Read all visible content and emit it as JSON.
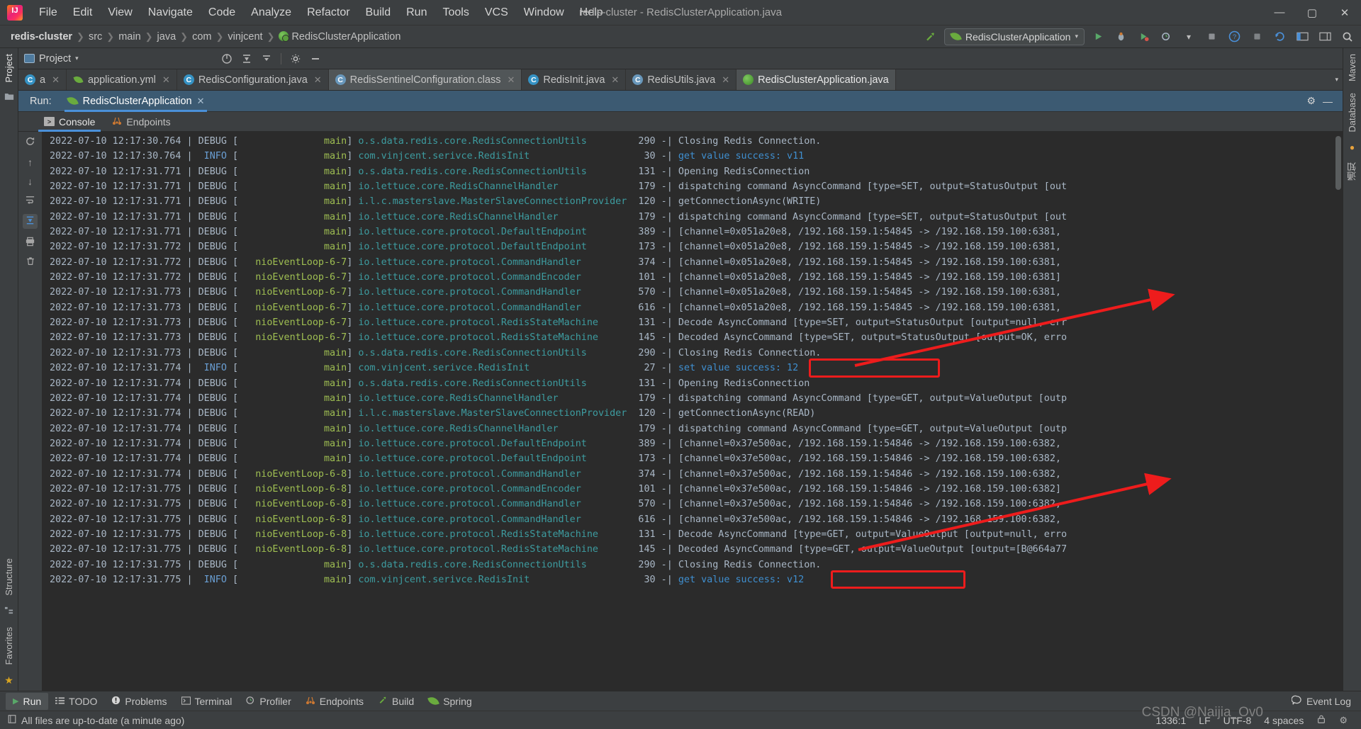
{
  "window": {
    "title": "redis-cluster - RedisClusterApplication.java",
    "minimize": "—",
    "maximize": "▢",
    "close": "✕"
  },
  "menu": {
    "items": [
      "File",
      "Edit",
      "View",
      "Navigate",
      "Code",
      "Analyze",
      "Refactor",
      "Build",
      "Run",
      "Tools",
      "VCS",
      "Window",
      "Help"
    ]
  },
  "breadcrumb": {
    "separator": "❯",
    "items": [
      "redis-cluster",
      "src",
      "main",
      "java",
      "com",
      "vinjcent",
      "RedisClusterApplication"
    ]
  },
  "toolbar": {
    "run_config": "RedisClusterApplication",
    "run_config_caret": "▾",
    "icons": {
      "build_hammer": "build-hammer-icon",
      "run": "▶",
      "debug": "debug-icon",
      "run_with_coverage": "coverage-icon",
      "profiler": "profiler-icon",
      "profiler_caret": "▾",
      "stop": "■",
      "help": "?",
      "update": "update-icon",
      "search": "🔍",
      "layout": "layout-icon",
      "settings_blue": "settings-icon"
    }
  },
  "project_panel": {
    "label": "Project",
    "caret": "▾",
    "tools": [
      "locate-icon",
      "expand-all-icon",
      "collapse-all-icon",
      "settings-gear-icon",
      "hide-icon"
    ]
  },
  "editor_tabs": [
    {
      "label": "a",
      "type": "java",
      "close": "✕",
      "selected": false
    },
    {
      "label": "application.yml",
      "type": "yml",
      "close": "✕",
      "selected": false
    },
    {
      "label": "RedisConfiguration.java",
      "type": "java",
      "close": "✕",
      "selected": false
    },
    {
      "label": "RedisSentinelConfiguration.class",
      "type": "javac",
      "close": "✕",
      "selected": false,
      "active_file": true
    },
    {
      "label": "RedisInit.java",
      "type": "java",
      "close": "✕",
      "selected": false
    },
    {
      "label": "RedisUtils.java",
      "type": "javac",
      "close": "✕",
      "selected": false
    },
    {
      "label": "RedisClusterApplication.java",
      "type": "spring-app",
      "close": "✕",
      "selected": true
    }
  ],
  "editor_tabs_overflow": "▾",
  "run_window": {
    "label": "Run:",
    "tab_title": "RedisClusterApplication",
    "tab_close": "✕",
    "settings_icon": "⚙",
    "minimize_icon": "—",
    "console_tabs": [
      {
        "label": "Console",
        "icon": "console-icon",
        "selected": true
      },
      {
        "label": "Endpoints",
        "icon": "endpoints-icon",
        "selected": false
      }
    ],
    "gutter_icons": [
      "rerun-icon",
      "scroll-up-icon",
      "scroll-down-icon",
      "soft-wrap-icon",
      "scroll-to-end-icon",
      "print-icon",
      "clear-all-icon"
    ]
  },
  "console_log": {
    "lines": [
      {
        "ts": "2022-07-10 12:17:30.764",
        "level": "DEBUG",
        "thread": "main",
        "logger": "o.s.data.redis.core.RedisConnectionUtils",
        "ln": "290",
        "msg": "Closing Redis Connection.",
        "msg_blue": false
      },
      {
        "ts": "2022-07-10 12:17:30.764",
        "level": "INFO",
        "thread": "main",
        "logger": "com.vinjcent.serivce.RedisInit",
        "ln": "30",
        "msg": "get value success: v11",
        "msg_blue": true
      },
      {
        "ts": "2022-07-10 12:17:31.771",
        "level": "DEBUG",
        "thread": "main",
        "logger": "o.s.data.redis.core.RedisConnectionUtils",
        "ln": "131",
        "msg": "Opening RedisConnection",
        "msg_blue": false
      },
      {
        "ts": "2022-07-10 12:17:31.771",
        "level": "DEBUG",
        "thread": "main",
        "logger": "io.lettuce.core.RedisChannelHandler",
        "ln": "179",
        "msg": "dispatching command AsyncCommand [type=SET, output=StatusOutput [out",
        "msg_blue": false
      },
      {
        "ts": "2022-07-10 12:17:31.771",
        "level": "DEBUG",
        "thread": "main",
        "logger": "i.l.c.masterslave.MasterSlaveConnectionProvider",
        "ln": "120",
        "msg": "getConnectionAsync(WRITE)",
        "msg_blue": false
      },
      {
        "ts": "2022-07-10 12:17:31.771",
        "level": "DEBUG",
        "thread": "main",
        "logger": "io.lettuce.core.RedisChannelHandler",
        "ln": "179",
        "msg": "dispatching command AsyncCommand [type=SET, output=StatusOutput [out",
        "msg_blue": false
      },
      {
        "ts": "2022-07-10 12:17:31.771",
        "level": "DEBUG",
        "thread": "main",
        "logger": "io.lettuce.core.protocol.DefaultEndpoint",
        "ln": "389",
        "msg": "[channel=0x051a20e8, /192.168.159.1:54845 -> /192.168.159.100:6381,",
        "msg_blue": false
      },
      {
        "ts": "2022-07-10 12:17:31.772",
        "level": "DEBUG",
        "thread": "main",
        "logger": "io.lettuce.core.protocol.DefaultEndpoint",
        "ln": "173",
        "msg": "[channel=0x051a20e8, /192.168.159.1:54845 -> /192.168.159.100:6381,",
        "msg_blue": false
      },
      {
        "ts": "2022-07-10 12:17:31.772",
        "level": "DEBUG",
        "thread": "nioEventLoop-6-7",
        "logger": "io.lettuce.core.protocol.CommandHandler",
        "ln": "374",
        "msg": "[channel=0x051a20e8, /192.168.159.1:54845 -> /192.168.159.100:6381,",
        "msg_blue": false
      },
      {
        "ts": "2022-07-10 12:17:31.772",
        "level": "DEBUG",
        "thread": "nioEventLoop-6-7",
        "logger": "io.lettuce.core.protocol.CommandEncoder",
        "ln": "101",
        "msg": "[channel=0x051a20e8, /192.168.159.1:54845 -> /192.168.159.100:6381]",
        "msg_blue": false
      },
      {
        "ts": "2022-07-10 12:17:31.773",
        "level": "DEBUG",
        "thread": "nioEventLoop-6-7",
        "logger": "io.lettuce.core.protocol.CommandHandler",
        "ln": "570",
        "msg": "[channel=0x051a20e8, /192.168.159.1:54845 -> /192.168.159.100:6381,",
        "msg_blue": false
      },
      {
        "ts": "2022-07-10 12:17:31.773",
        "level": "DEBUG",
        "thread": "nioEventLoop-6-7",
        "logger": "io.lettuce.core.protocol.CommandHandler",
        "ln": "616",
        "msg": "[channel=0x051a20e8, /192.168.159.1:54845 -> /192.168.159.100:6381,",
        "msg_blue": false
      },
      {
        "ts": "2022-07-10 12:17:31.773",
        "level": "DEBUG",
        "thread": "nioEventLoop-6-7",
        "logger": "io.lettuce.core.protocol.RedisStateMachine",
        "ln": "131",
        "msg": "Decode AsyncCommand [type=SET, output=StatusOutput [output=null, err",
        "msg_blue": false
      },
      {
        "ts": "2022-07-10 12:17:31.773",
        "level": "DEBUG",
        "thread": "nioEventLoop-6-7",
        "logger": "io.lettuce.core.protocol.RedisStateMachine",
        "ln": "145",
        "msg": "Decoded AsyncCommand [type=SET, output=StatusOutput [output=OK, erro",
        "msg_blue": false
      },
      {
        "ts": "2022-07-10 12:17:31.773",
        "level": "DEBUG",
        "thread": "main",
        "logger": "o.s.data.redis.core.RedisConnectionUtils",
        "ln": "290",
        "msg": "Closing Redis Connection.",
        "msg_blue": false
      },
      {
        "ts": "2022-07-10 12:17:31.774",
        "level": "INFO",
        "thread": "main",
        "logger": "com.vinjcent.serivce.RedisInit",
        "ln": "27",
        "msg": "set value success: 12",
        "msg_blue": true,
        "highlighted": true
      },
      {
        "ts": "2022-07-10 12:17:31.774",
        "level": "DEBUG",
        "thread": "main",
        "logger": "o.s.data.redis.core.RedisConnectionUtils",
        "ln": "131",
        "msg": "Opening RedisConnection",
        "msg_blue": false
      },
      {
        "ts": "2022-07-10 12:17:31.774",
        "level": "DEBUG",
        "thread": "main",
        "logger": "io.lettuce.core.RedisChannelHandler",
        "ln": "179",
        "msg": "dispatching command AsyncCommand [type=GET, output=ValueOutput [outp",
        "msg_blue": false
      },
      {
        "ts": "2022-07-10 12:17:31.774",
        "level": "DEBUG",
        "thread": "main",
        "logger": "i.l.c.masterslave.MasterSlaveConnectionProvider",
        "ln": "120",
        "msg": "getConnectionAsync(READ)",
        "msg_blue": false
      },
      {
        "ts": "2022-07-10 12:17:31.774",
        "level": "DEBUG",
        "thread": "main",
        "logger": "io.lettuce.core.RedisChannelHandler",
        "ln": "179",
        "msg": "dispatching command AsyncCommand [type=GET, output=ValueOutput [outp",
        "msg_blue": false
      },
      {
        "ts": "2022-07-10 12:17:31.774",
        "level": "DEBUG",
        "thread": "main",
        "logger": "io.lettuce.core.protocol.DefaultEndpoint",
        "ln": "389",
        "msg": "[channel=0x37e500ac, /192.168.159.1:54846 -> /192.168.159.100:6382,",
        "msg_blue": false
      },
      {
        "ts": "2022-07-10 12:17:31.774",
        "level": "DEBUG",
        "thread": "main",
        "logger": "io.lettuce.core.protocol.DefaultEndpoint",
        "ln": "173",
        "msg": "[channel=0x37e500ac, /192.168.159.1:54846 -> /192.168.159.100:6382,",
        "msg_blue": false
      },
      {
        "ts": "2022-07-10 12:17:31.774",
        "level": "DEBUG",
        "thread": "nioEventLoop-6-8",
        "logger": "io.lettuce.core.protocol.CommandHandler",
        "ln": "374",
        "msg": "[channel=0x37e500ac, /192.168.159.1:54846 -> /192.168.159.100:6382,",
        "msg_blue": false
      },
      {
        "ts": "2022-07-10 12:17:31.775",
        "level": "DEBUG",
        "thread": "nioEventLoop-6-8",
        "logger": "io.lettuce.core.protocol.CommandEncoder",
        "ln": "101",
        "msg": "[channel=0x37e500ac, /192.168.159.1:54846 -> /192.168.159.100:6382]",
        "msg_blue": false
      },
      {
        "ts": "2022-07-10 12:17:31.775",
        "level": "DEBUG",
        "thread": "nioEventLoop-6-8",
        "logger": "io.lettuce.core.protocol.CommandHandler",
        "ln": "570",
        "msg": "[channel=0x37e500ac, /192.168.159.1:54846 -> /192.168.159.100:6382,",
        "msg_blue": false
      },
      {
        "ts": "2022-07-10 12:17:31.775",
        "level": "DEBUG",
        "thread": "nioEventLoop-6-8",
        "logger": "io.lettuce.core.protocol.CommandHandler",
        "ln": "616",
        "msg": "[channel=0x37e500ac, /192.168.159.1:54846 -> /192.168.159.100:6382,",
        "msg_blue": false
      },
      {
        "ts": "2022-07-10 12:17:31.775",
        "level": "DEBUG",
        "thread": "nioEventLoop-6-8",
        "logger": "io.lettuce.core.protocol.RedisStateMachine",
        "ln": "131",
        "msg": "Decode AsyncCommand [type=GET, output=ValueOutput [output=null, erro",
        "msg_blue": false
      },
      {
        "ts": "2022-07-10 12:17:31.775",
        "level": "DEBUG",
        "thread": "nioEventLoop-6-8",
        "logger": "io.lettuce.core.protocol.RedisStateMachine",
        "ln": "145",
        "msg": "Decoded AsyncCommand [type=GET, output=ValueOutput [output=[B@664a77",
        "msg_blue": false
      },
      {
        "ts": "2022-07-10 12:17:31.775",
        "level": "DEBUG",
        "thread": "main",
        "logger": "o.s.data.redis.core.RedisConnectionUtils",
        "ln": "290",
        "msg": "Closing Redis Connection.",
        "msg_blue": false
      },
      {
        "ts": "2022-07-10 12:17:31.775",
        "level": "INFO",
        "thread": "main",
        "logger": "com.vinjcent.serivce.RedisInit",
        "ln": "30",
        "msg": "get value success: v12",
        "msg_blue": true,
        "highlighted": true
      }
    ]
  },
  "annotations": {
    "box_color": "#ee1c1c",
    "arrow_color": "#ee1c1c",
    "count": 2
  },
  "left_rail": {
    "project_label": "Project",
    "structure_label": "Structure",
    "favorites_label": "Favorites"
  },
  "right_rail": {
    "maven_label": "Maven",
    "database_label": "Database",
    "notifications_label": "通知"
  },
  "bottom_tabs": [
    {
      "label": "Run",
      "icon": "run-icon",
      "selected": true
    },
    {
      "label": "TODO",
      "icon": "todo-icon",
      "selected": false
    },
    {
      "label": "Problems",
      "icon": "problems-icon",
      "selected": false
    },
    {
      "label": "Terminal",
      "icon": "terminal-icon",
      "selected": false
    },
    {
      "label": "Profiler",
      "icon": "profiler-icon",
      "selected": false
    },
    {
      "label": "Endpoints",
      "icon": "endpoints-icon",
      "selected": false
    },
    {
      "label": "Build",
      "icon": "build-icon",
      "selected": false
    },
    {
      "label": "Spring",
      "icon": "spring-icon",
      "selected": false
    }
  ],
  "bottom_right": {
    "event_log": "Event Log",
    "event_log_icon": "event-log-icon"
  },
  "statusbar": {
    "message": "All files are up-to-date (a minute ago)",
    "message_icon": "book-icon",
    "caret_position": "1336:1",
    "line_separator": "LF",
    "encoding": "UTF-8",
    "indent": "4 spaces",
    "lock_icon": "lock-icon",
    "gear_icon": "⚙"
  },
  "watermark": "CSDN @Naijia_Ov0"
}
